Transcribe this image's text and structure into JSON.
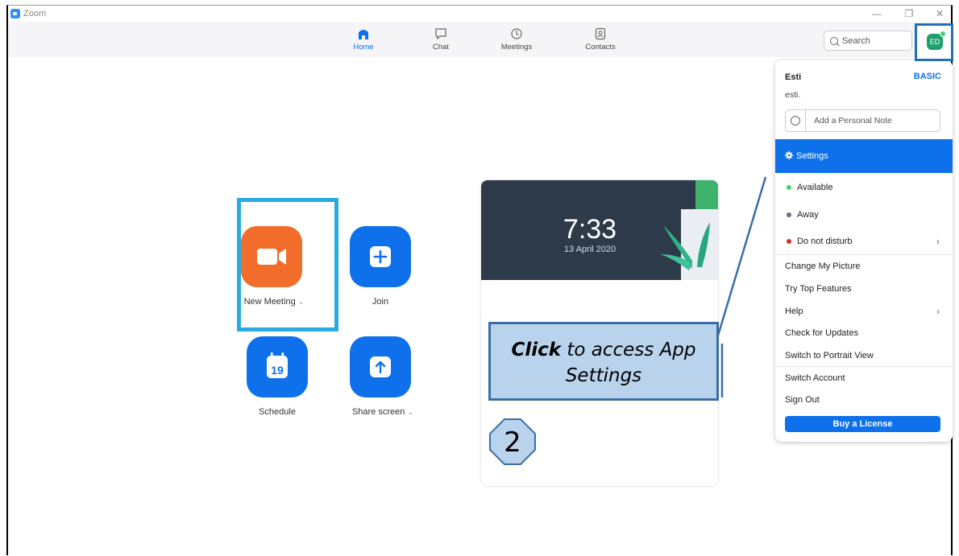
{
  "window": {
    "title": "Zoom",
    "minimize": "—",
    "restore": "❐",
    "close": "✕"
  },
  "nav": {
    "tabs": [
      {
        "label": "Home",
        "icon": "home-icon"
      },
      {
        "label": "Chat",
        "icon": "chat-icon"
      },
      {
        "label": "Meetings",
        "icon": "clock-icon"
      },
      {
        "label": "Contacts",
        "icon": "contacts-icon"
      }
    ],
    "search_label": "Search"
  },
  "profile": {
    "initials": "ED"
  },
  "home": {
    "new_meeting": "New Meeting",
    "join": "Join",
    "schedule": "Schedule",
    "schedule_day": "19",
    "share_screen": "Share screen"
  },
  "card": {
    "time": "7:33",
    "date": "13 April 2020"
  },
  "callout": {
    "bold": "Click",
    "text": " to access App Settings",
    "step": "2"
  },
  "dropdown": {
    "name": "Esti",
    "plan": "BASIC",
    "email": "esti.",
    "note_placeholder": "Add a Personal Note",
    "settings": "Settings",
    "available": "Available",
    "away": "Away",
    "dnd": "Do not disturb",
    "change_picture": "Change My Picture",
    "top_features": "Try Top Features",
    "help": "Help",
    "updates": "Check for Updates",
    "portrait": "Switch to Portrait View",
    "switch_account": "Switch Account",
    "sign_out": "Sign Out",
    "buy": "Buy a License"
  },
  "colors": {
    "accent": "#0e71eb",
    "new_meeting": "#f26d2c",
    "highlight": "#29abe2",
    "available": "#3bd46b",
    "away": "#6b6b8a",
    "dnd": "#e02828"
  }
}
